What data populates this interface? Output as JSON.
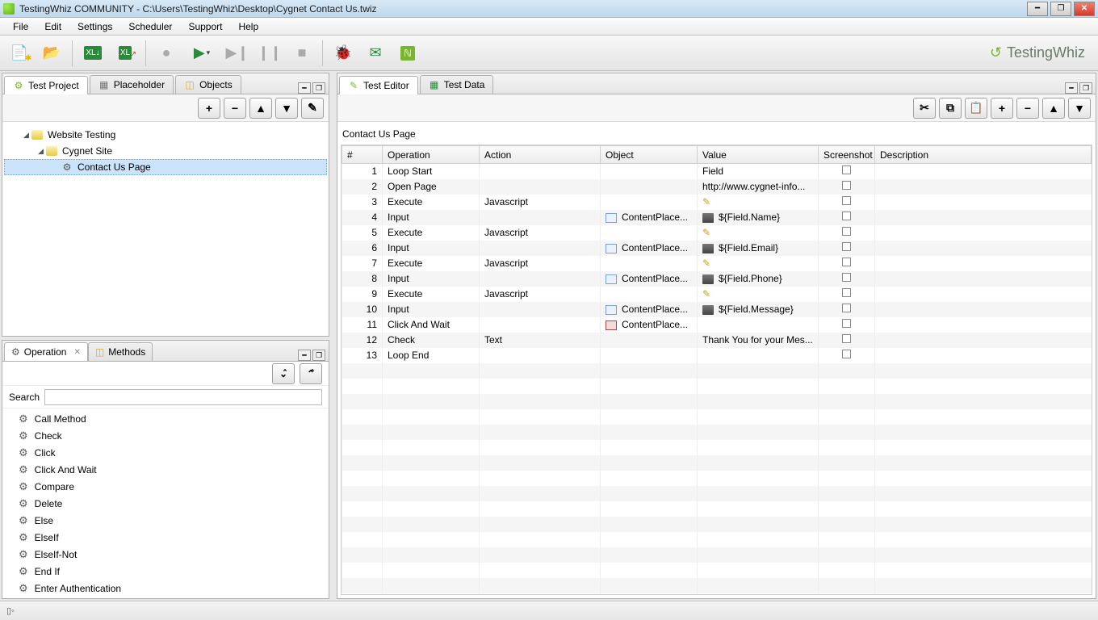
{
  "window": {
    "title": "TestingWhiz COMMUNITY - C:\\Users\\TestingWhiz\\Desktop\\Cygnet Contact Us.twiz"
  },
  "menu": {
    "items": [
      "File",
      "Edit",
      "Settings",
      "Scheduler",
      "Support",
      "Help"
    ]
  },
  "brand": {
    "name": "TestingWhiz"
  },
  "left_tabs": {
    "items": [
      "Test Project",
      "Placeholder",
      "Objects"
    ],
    "active": 0
  },
  "tree": {
    "root": "Website Testing",
    "child": "Cygnet Site",
    "leaf": "Contact Us Page"
  },
  "op_tabs": {
    "op": "Operation",
    "methods": "Methods"
  },
  "search_label": "Search",
  "operations": [
    "Call Method",
    "Check",
    "Click",
    "Click And Wait",
    "Compare",
    "Delete",
    "Else",
    "ElseIf",
    "ElseIf-Not",
    "End If",
    "Enter Authentication"
  ],
  "right_tabs": {
    "items": [
      "Test Editor",
      "Test Data"
    ],
    "active": 0
  },
  "editor": {
    "page_name": "Contact Us Page",
    "columns": [
      "#",
      "Operation",
      "Action",
      "Object",
      "Value",
      "Screenshot",
      "Description"
    ],
    "rows": [
      {
        "n": "1",
        "op": "Loop Start",
        "action": "",
        "object": "",
        "value": "Field",
        "vicon": ""
      },
      {
        "n": "2",
        "op": "Open Page",
        "action": "",
        "object": "",
        "value": "http://www.cygnet-info...",
        "vicon": ""
      },
      {
        "n": "3",
        "op": "Execute",
        "action": "Javascript",
        "object": "",
        "value": "",
        "vicon": "edit"
      },
      {
        "n": "4",
        "op": "Input",
        "action": "",
        "object": "ContentPlace...",
        "value": "${Field.Name}",
        "vicon": "db"
      },
      {
        "n": "5",
        "op": "Execute",
        "action": "Javascript",
        "object": "",
        "value": "",
        "vicon": "edit"
      },
      {
        "n": "6",
        "op": "Input",
        "action": "",
        "object": "ContentPlace...",
        "value": "${Field.Email}",
        "vicon": "db"
      },
      {
        "n": "7",
        "op": "Execute",
        "action": "Javascript",
        "object": "",
        "value": "",
        "vicon": "edit"
      },
      {
        "n": "8",
        "op": "Input",
        "action": "",
        "object": "ContentPlace...",
        "value": "${Field.Phone}",
        "vicon": "db"
      },
      {
        "n": "9",
        "op": "Execute",
        "action": "Javascript",
        "object": "",
        "value": "",
        "vicon": "edit"
      },
      {
        "n": "10",
        "op": "Input",
        "action": "",
        "object": "ContentPlace...",
        "value": "${Field.Message}",
        "vicon": "db"
      },
      {
        "n": "11",
        "op": "Click And Wait",
        "action": "",
        "object": "ContentPlace...",
        "value": "",
        "vicon": ""
      },
      {
        "n": "12",
        "op": "Check",
        "action": "Text",
        "object": "",
        "value": "Thank You for your Mes...",
        "vicon": ""
      },
      {
        "n": "13",
        "op": "Loop End",
        "action": "",
        "object": "",
        "value": "",
        "vicon": ""
      }
    ]
  }
}
